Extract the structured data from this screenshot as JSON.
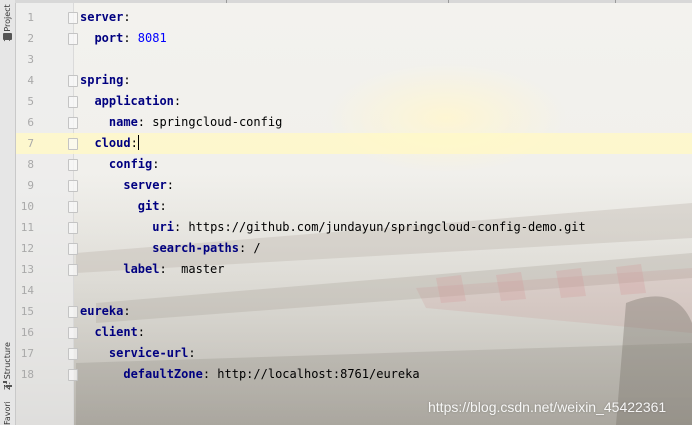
{
  "tool_window_tabs": {
    "project": "1: Project",
    "structure": "Z: Structure",
    "favorites": "Favorites"
  },
  "editor": {
    "current_line": 7,
    "lines": [
      {
        "n": "1",
        "indent": 0,
        "key": "server",
        "sep": ":",
        "value": "",
        "value_type": ""
      },
      {
        "n": "2",
        "indent": 1,
        "key": "port",
        "sep": ": ",
        "value": "8081",
        "value_type": "number"
      },
      {
        "n": "3",
        "indent": 0,
        "key": "",
        "sep": "",
        "value": "",
        "value_type": ""
      },
      {
        "n": "4",
        "indent": 0,
        "key": "spring",
        "sep": ":",
        "value": "",
        "value_type": ""
      },
      {
        "n": "5",
        "indent": 1,
        "key": "application",
        "sep": ":",
        "value": "",
        "value_type": ""
      },
      {
        "n": "6",
        "indent": 2,
        "key": "name",
        "sep": ": ",
        "value": "springcloud-config",
        "value_type": "string"
      },
      {
        "n": "7",
        "indent": 1,
        "key": "cloud",
        "sep": ":",
        "value": "",
        "value_type": ""
      },
      {
        "n": "8",
        "indent": 2,
        "key": "config",
        "sep": ":",
        "value": "",
        "value_type": ""
      },
      {
        "n": "9",
        "indent": 3,
        "key": "server",
        "sep": ":",
        "value": "",
        "value_type": ""
      },
      {
        "n": "10",
        "indent": 4,
        "key": "git",
        "sep": ":",
        "value": "",
        "value_type": ""
      },
      {
        "n": "11",
        "indent": 5,
        "key": "uri",
        "sep": ": ",
        "value": "https://github.com/jundayun/springcloud-config-demo.git",
        "value_type": "string"
      },
      {
        "n": "12",
        "indent": 5,
        "key": "search-paths",
        "sep": ": ",
        "value": "/",
        "value_type": "string"
      },
      {
        "n": "13",
        "indent": 3,
        "key": "label",
        "sep": ":  ",
        "value": "master",
        "value_type": "string"
      },
      {
        "n": "14",
        "indent": 0,
        "key": "",
        "sep": "",
        "value": "",
        "value_type": ""
      },
      {
        "n": "15",
        "indent": 0,
        "key": "eureka",
        "sep": ":",
        "value": "",
        "value_type": ""
      },
      {
        "n": "16",
        "indent": 1,
        "key": "client",
        "sep": ":",
        "value": "",
        "value_type": ""
      },
      {
        "n": "17",
        "indent": 2,
        "key": "service-url",
        "sep": ":",
        "value": "",
        "value_type": ""
      },
      {
        "n": "18",
        "indent": 3,
        "key": "defaultZone",
        "sep": ": ",
        "value": "http://localhost:8761/eureka",
        "value_type": "string"
      }
    ]
  },
  "watermark": "https://blog.csdn.net/weixin_45422361",
  "colors": {
    "key": "#000080",
    "number": "#0000ff",
    "current_line": "#fff8c8",
    "line_number": "#a9a9a9"
  }
}
